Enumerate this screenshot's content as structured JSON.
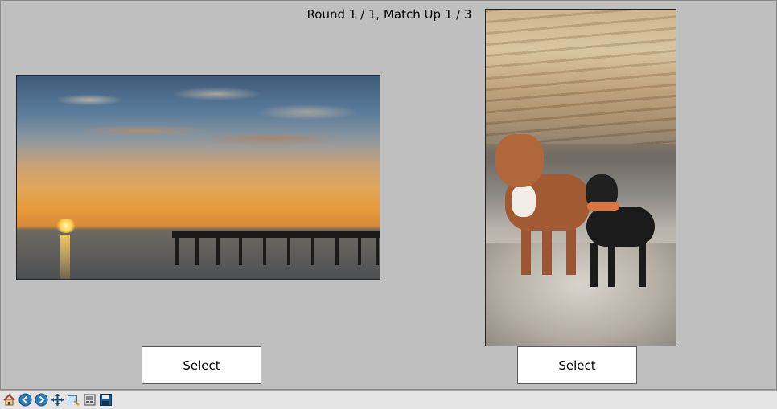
{
  "header": {
    "title": "Round 1 / 1, Match Up 1 / 3"
  },
  "left_image": {
    "description_icon": "sunset-pier-photo",
    "select_label": "Select"
  },
  "right_image": {
    "description_icon": "dogs-on-rocks-photo",
    "select_label": "Select"
  },
  "toolbar": {
    "buttons": [
      {
        "icon": "home-icon"
      },
      {
        "icon": "back-arrow-icon"
      },
      {
        "icon": "forward-arrow-icon"
      },
      {
        "icon": "pan-move-icon"
      },
      {
        "icon": "zoom-rect-icon"
      },
      {
        "icon": "configure-subplots-icon"
      },
      {
        "icon": "save-icon"
      }
    ]
  },
  "colors": {
    "canvas_bg": "#bfbfbf",
    "toolbar_bg": "#e4e4e4",
    "button_bg": "#ffffff"
  }
}
